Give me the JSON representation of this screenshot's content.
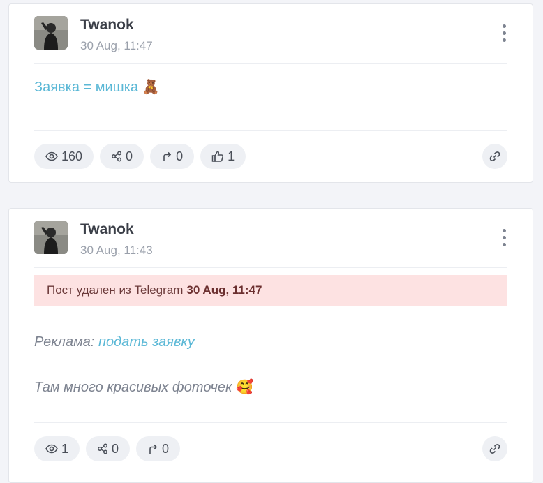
{
  "posts": [
    {
      "author": "Twanok",
      "date": "30 Aug, 11:47",
      "text": "Заявка = мишка",
      "text_emoji": "🧸",
      "stats": {
        "views": "160",
        "shares": "0",
        "forwards": "0",
        "likes": "1"
      }
    },
    {
      "author": "Twanok",
      "date": "30 Aug, 11:43",
      "deleted_notice": "Пост удален из Telegram",
      "deleted_date": "30 Aug, 11:47",
      "ad_label": "Реклама:",
      "ad_link": "подать заявку",
      "text": "Там много красивых фоточек",
      "text_emoji": "🥰",
      "stats": {
        "views": "1",
        "shares": "0",
        "forwards": "0"
      }
    }
  ],
  "colors": {
    "link": "#5bb8d6",
    "alert_bg": "#fde2e2",
    "pill_bg": "#eef0f4"
  }
}
